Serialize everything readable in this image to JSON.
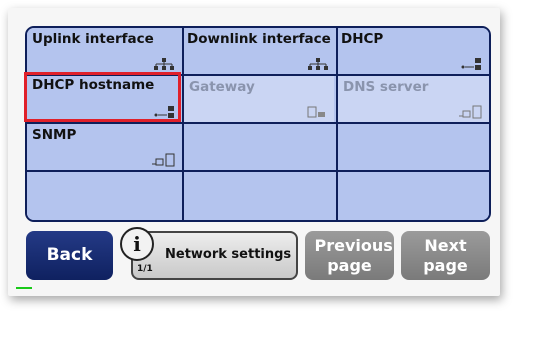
{
  "grid": {
    "cells": [
      {
        "label": "Uplink interface",
        "icon": "network-icon",
        "disabled": false
      },
      {
        "label": "Downlink interface",
        "icon": "network-icon",
        "disabled": false
      },
      {
        "label": "DHCP",
        "icon": "dhcp-icon",
        "disabled": false
      },
      {
        "label": "DHCP hostname",
        "icon": "dhcp-icon",
        "disabled": false,
        "selected": true
      },
      {
        "label": "Gateway",
        "icon": "gateway-icon",
        "disabled": true
      },
      {
        "label": "DNS server",
        "icon": "server-icon",
        "disabled": true
      },
      {
        "label": "SNMP",
        "icon": "server-icon",
        "disabled": false
      },
      {
        "label": "",
        "disabled": false
      },
      {
        "label": "",
        "disabled": false
      },
      {
        "label": "",
        "disabled": false
      },
      {
        "label": "",
        "disabled": false
      },
      {
        "label": "",
        "disabled": false
      }
    ]
  },
  "footer": {
    "back_label": "Back",
    "info_title": "Network settings",
    "page_count": "1/1",
    "previous_label": "Previous page",
    "next_label": "Next page"
  },
  "colors": {
    "grid_bg": "#b4c4ee",
    "grid_border": "#0e1f5a",
    "selection": "#e0202a",
    "back_button": "#1a2c70",
    "nav_button_disabled": "#8a8a8a"
  }
}
